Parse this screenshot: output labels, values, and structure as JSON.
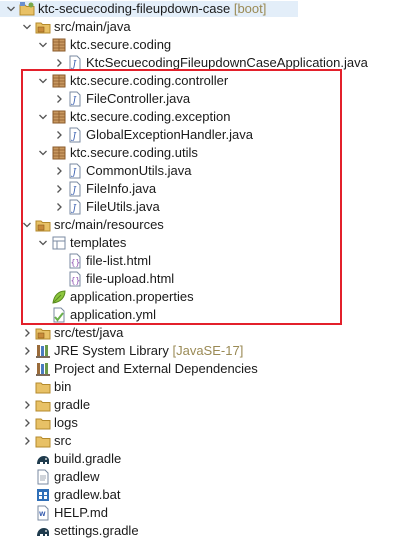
{
  "tree": [
    {
      "label": "ktc-secuecoding-fileupdown-case",
      "suffix": " [boot]",
      "icon": "project-folder-icon",
      "indent": 0,
      "arrow": "down",
      "selected": true
    },
    {
      "label": "src/main/java",
      "icon": "source-folder-icon",
      "indent": 1,
      "arrow": "down"
    },
    {
      "label": "ktc.secure.coding",
      "icon": "package-icon",
      "indent": 2,
      "arrow": "down"
    },
    {
      "label": "KtcSecuecodingFileupdownCaseApplication.java",
      "icon": "java-file-icon",
      "indent": 3,
      "arrow": "right"
    },
    {
      "label": "ktc.secure.coding.controller",
      "icon": "package-icon",
      "indent": 2,
      "arrow": "down"
    },
    {
      "label": "FileController.java",
      "icon": "java-file-icon",
      "indent": 3,
      "arrow": "right"
    },
    {
      "label": "ktc.secure.coding.exception",
      "icon": "package-icon",
      "indent": 2,
      "arrow": "down"
    },
    {
      "label": "GlobalExceptionHandler.java",
      "icon": "java-file-icon",
      "indent": 3,
      "arrow": "right"
    },
    {
      "label": "ktc.secure.coding.utils",
      "icon": "package-icon",
      "indent": 2,
      "arrow": "down"
    },
    {
      "label": "CommonUtils.java",
      "icon": "java-file-icon",
      "indent": 3,
      "arrow": "right"
    },
    {
      "label": "FileInfo.java",
      "icon": "java-file-icon",
      "indent": 3,
      "arrow": "right"
    },
    {
      "label": "FileUtils.java",
      "icon": "java-file-icon",
      "indent": 3,
      "arrow": "right"
    },
    {
      "label": "src/main/resources",
      "icon": "source-folder-icon",
      "indent": 1,
      "arrow": "down"
    },
    {
      "label": "templates",
      "icon": "templates-folder-icon",
      "indent": 2,
      "arrow": "down"
    },
    {
      "label": "file-list.html",
      "icon": "html-file-icon",
      "indent": 3,
      "arrow": "none"
    },
    {
      "label": "file-upload.html",
      "icon": "html-file-icon",
      "indent": 3,
      "arrow": "none"
    },
    {
      "label": "application.properties",
      "icon": "properties-leaf-icon",
      "indent": 2,
      "arrow": "none"
    },
    {
      "label": "application.yml",
      "icon": "yml-file-icon",
      "indent": 2,
      "arrow": "none"
    },
    {
      "label": "src/test/java",
      "icon": "source-folder-icon",
      "indent": 1,
      "arrow": "right"
    },
    {
      "label": "JRE System Library",
      "suffix": " [JavaSE-17]",
      "icon": "library-icon",
      "indent": 1,
      "arrow": "right"
    },
    {
      "label": "Project and External Dependencies",
      "icon": "library-icon",
      "indent": 1,
      "arrow": "right"
    },
    {
      "label": "bin",
      "icon": "folder-icon",
      "indent": 1,
      "arrow": "none"
    },
    {
      "label": "gradle",
      "icon": "folder-icon",
      "indent": 1,
      "arrow": "right"
    },
    {
      "label": "logs",
      "icon": "folder-icon",
      "indent": 1,
      "arrow": "right"
    },
    {
      "label": "src",
      "icon": "folder-icon",
      "indent": 1,
      "arrow": "right"
    },
    {
      "label": "build.gradle",
      "icon": "gradle-elephant-icon",
      "indent": 1,
      "arrow": "none"
    },
    {
      "label": "gradlew",
      "icon": "text-file-icon",
      "indent": 1,
      "arrow": "none"
    },
    {
      "label": "gradlew.bat",
      "icon": "bat-file-icon",
      "indent": 1,
      "arrow": "none"
    },
    {
      "label": "HELP.md",
      "icon": "markdown-file-icon",
      "indent": 1,
      "arrow": "none"
    },
    {
      "label": "settings.gradle",
      "icon": "gradle-elephant-icon",
      "indent": 1,
      "arrow": "none"
    }
  ],
  "colors": {
    "highlight_border": "#e3202b",
    "selection_bg": "#e3eef9",
    "decoration_text": "#9a8a55"
  }
}
